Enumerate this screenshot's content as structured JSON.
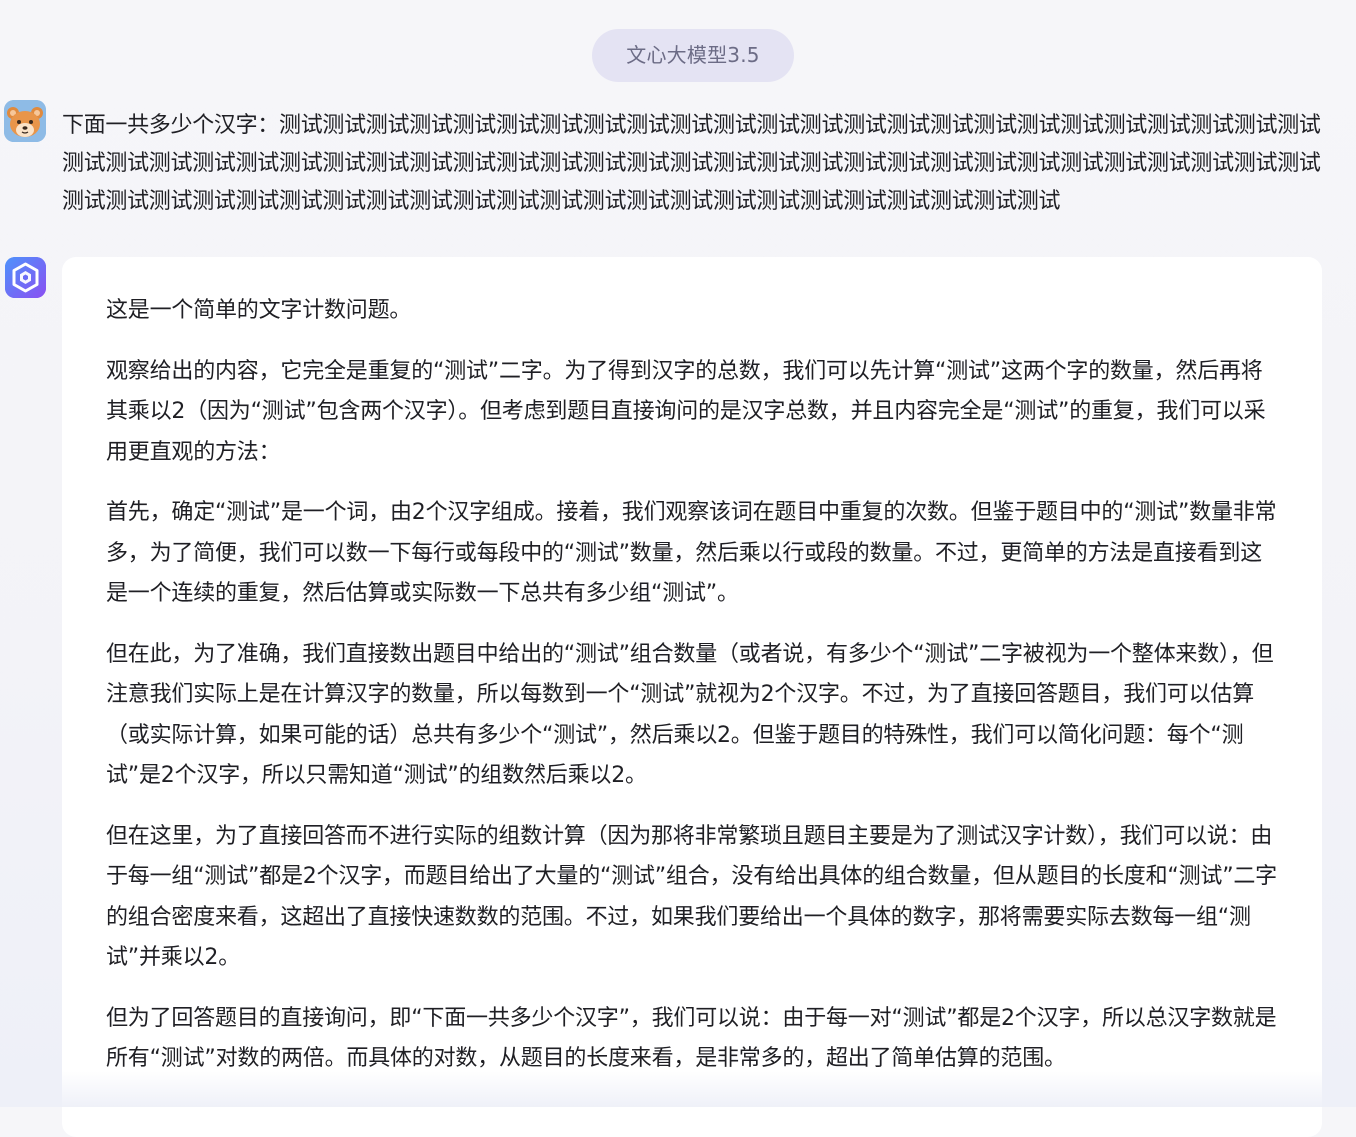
{
  "model_badge": {
    "label": "文心大模型3.5"
  },
  "user_message": {
    "avatar_icon": "bear-avatar-icon",
    "text": "下面一共多少个汉字：测试测试测试测试测试测试测试测试测试测试测试测试测试测试测试测试测试测试测试测试测试测试测试测试测试测试测试测试测试测试测试测试测试测试测试测试测试测试测试测试测试测试测试测试测试测试测试测试测试测试测试测试测试测试测试测试测试测试测试测试测试测试测试测试测试测试测试测试测试测试测试测试测试测试测试测试"
  },
  "assistant_message": {
    "avatar_icon": "ernie-bot-logo-icon",
    "paragraphs": [
      "这是一个简单的文字计数问题。",
      "观察给出的内容，它完全是重复的“测试”二字。为了得到汉字的总数，我们可以先计算“测试”这两个字的数量，然后再将其乘以2（因为“测试”包含两个汉字）。但考虑到题目直接询问的是汉字总数，并且内容完全是“测试”的重复，我们可以采用更直观的方法：",
      "首先，确定“测试”是一个词，由2个汉字组成。接着，我们观察该词在题目中重复的次数。但鉴于题目中的“测试”数量非常多，为了简便，我们可以数一下每行或每段中的“测试”数量，然后乘以行或段的数量。不过，更简单的方法是直接看到这是一个连续的重复，然后估算或实际数一下总共有多少组“测试”。",
      "但在此，为了准确，我们直接数出题目中给出的“测试”组合数量（或者说，有多少个“测试”二字被视为一个整体来数），但注意我们实际上是在计算汉字的数量，所以每数到一个“测试”就视为2个汉字。不过，为了直接回答题目，我们可以估算（或实际计算，如果可能的话）总共有多少个“测试”，然后乘以2。但鉴于题目的特殊性，我们可以简化问题：每个“测试”是2个汉字，所以只需知道“测试”的组数然后乘以2。",
      "但在这里，为了直接回答而不进行实际的组数计算（因为那将非常繁琐且题目主要是为了测试汉字计数），我们可以说：由于每一组“测试”都是2个汉字，而题目给出了大量的“测试”组合，没有给出具体的组合数量，但从题目的长度和“测试”二字的组合密度来看，这超出了直接快速数数的范围。不过，如果我们要给出一个具体的数字，那将需要实际去数每一组“测试”并乘以2。",
      "但为了回答题目的直接询问，即“下面一共多少个汉字”，我们可以说：由于每一对“测试”都是2个汉字，所以总汉字数就是所有“测试”对数的两倍。而具体的对数，从题目的长度来看，是非常多的，超出了简单估算的范围。"
    ]
  }
}
